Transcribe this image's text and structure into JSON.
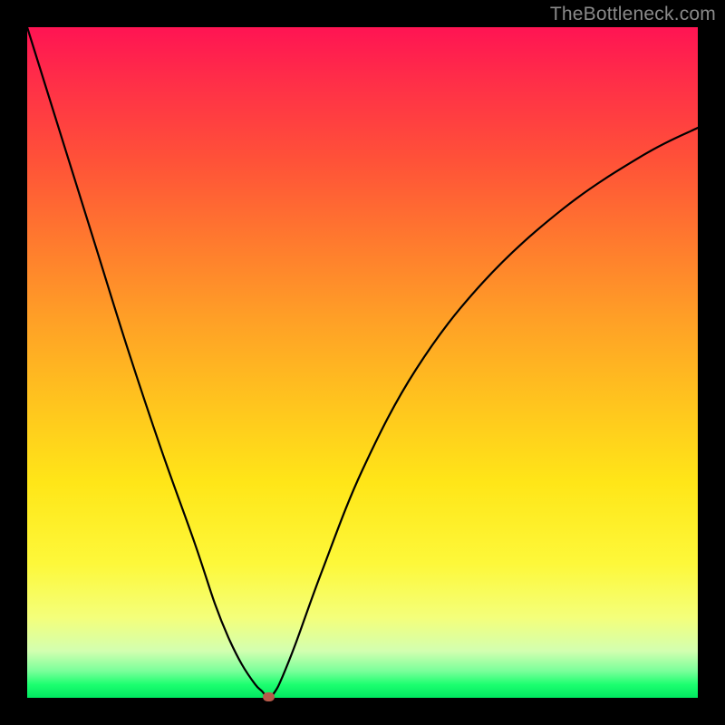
{
  "watermark": "TheBottleneck.com",
  "chart_data": {
    "type": "line",
    "title": "",
    "xlabel": "",
    "ylabel": "",
    "xlim": [
      0,
      100
    ],
    "ylim": [
      0,
      100
    ],
    "grid": false,
    "legend": false,
    "curve": {
      "x": [
        0,
        5,
        10,
        15,
        20,
        25,
        28,
        30,
        32,
        34,
        35,
        36,
        37,
        38,
        40,
        44,
        50,
        58,
        68,
        80,
        92,
        100
      ],
      "y": [
        100,
        84,
        68,
        52,
        37,
        23,
        14,
        9,
        5,
        2,
        1,
        0,
        1,
        3,
        8,
        19,
        34,
        49,
        62,
        73,
        81,
        85
      ]
    },
    "marker": {
      "x": 36,
      "y": 0,
      "shape": "rounded-rect",
      "color": "#b85a4a"
    },
    "background_gradient": {
      "direction": "vertical",
      "stops": [
        {
          "pos": 0.0,
          "color": "#ff1453"
        },
        {
          "pos": 0.2,
          "color": "#ff5238"
        },
        {
          "pos": 0.44,
          "color": "#ffa126"
        },
        {
          "pos": 0.68,
          "color": "#ffe618"
        },
        {
          "pos": 0.88,
          "color": "#f4ff7a"
        },
        {
          "pos": 0.96,
          "color": "#7aff9a"
        },
        {
          "pos": 1.0,
          "color": "#00e860"
        }
      ]
    }
  }
}
